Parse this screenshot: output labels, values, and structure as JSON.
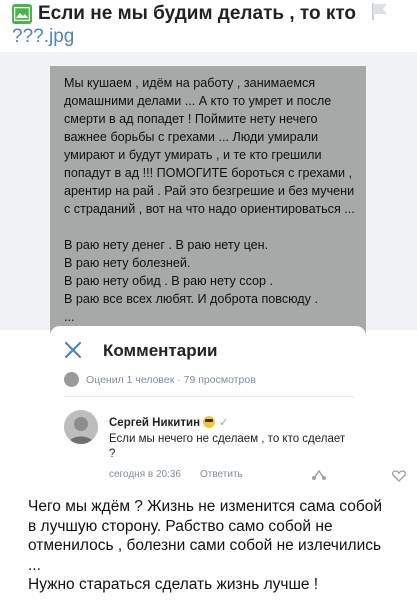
{
  "header": {
    "title": "Если не мы будим делать , то кто ",
    "title_ext": "???.jpg",
    "icon": "image-file-icon",
    "flag_icon": "flag-icon"
  },
  "photo": {
    "text": "Мы кушаем , идём на работу , занимаемся домашними делами ... А кто то умрет и после смерти в ад попадет ! Поймите нету нечего важнее борьбы с грехами ... Люди умирали умирают и будут умирать , и те кто грешили попадут в ад !!! ПОМОГИТЕ бороться с грехами , арентир на рай . Рай это безгрешие и без мучени с страданий , вот на что надо ориентироваться ...\n\nВ раю нету денег . В раю нету цен.\nВ раю нету болезней.\nВ раю нету обид . В раю нету ссор .\nВ раю все всех любят. И доброта повсюду .\n..."
  },
  "comments": {
    "title": "Комментарии",
    "stats": "Оценил 1 человек · 79 просмотров",
    "author": "Сергей Никитин",
    "author_badge": "✓",
    "text": "Если мы нечего не сделаем , то кто сделает ?",
    "time": "сегодня в 20:36",
    "reply_label": "Ответить"
  },
  "body": {
    "text": "Чего мы ждём ? Жизнь не изменится сама собой в лучшую сторону. Рабство само собой не отменилось , болезни сами собой не излечились ...\nНужно стараться сделать жизнь лучше !"
  },
  "colors": {
    "accent": "#5181b8",
    "photo_bg": "#a7a9a9",
    "muted": "#818c99",
    "file_icon": "#4bb34b"
  }
}
